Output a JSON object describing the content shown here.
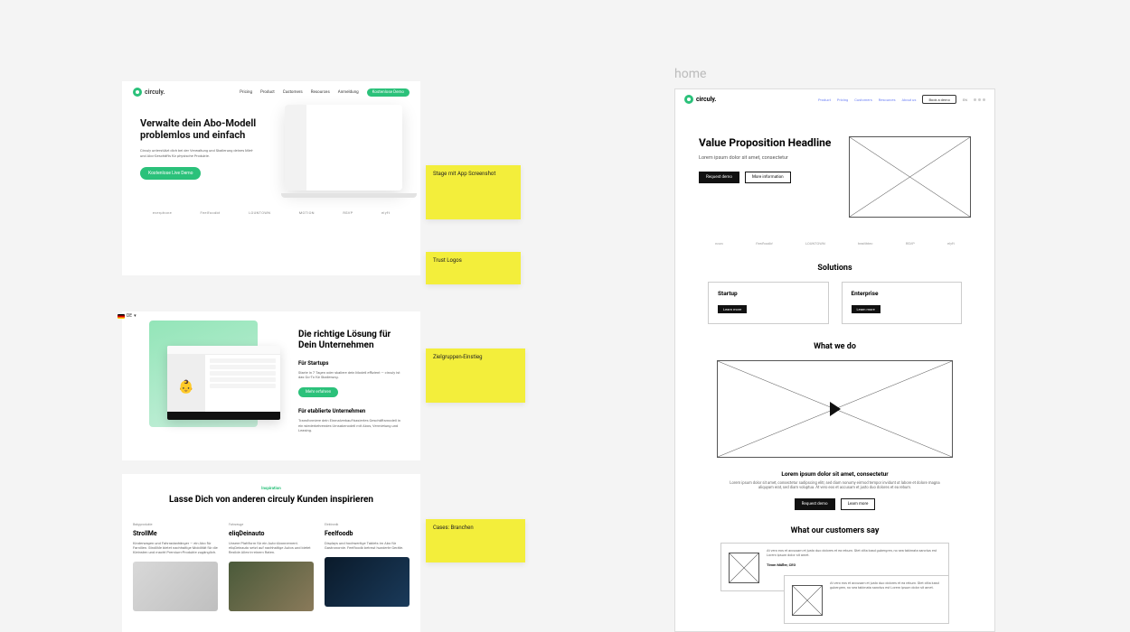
{
  "brand": "circuly.",
  "left": {
    "nav": {
      "items": [
        "Pricing",
        "Product",
        "Customers",
        "Resources"
      ],
      "login": "Anmeldung",
      "cta": "Kostenlose Demo"
    },
    "hero": {
      "headline": "Verwalte dein Abo-Modell problemlos und einfach",
      "sub": "Circuly unterstützt dich bei der Verwaltung und Skalierung deines Miet- und Abo-Geschäfts für physische Produkte.",
      "cta": "Kostenlose Live Demo",
      "trust": [
        "everphone",
        "Feelfoodbt",
        "LOUNTOWN",
        "MOTION",
        "RSVP",
        "elyft"
      ]
    },
    "solutions": {
      "lang": "DE",
      "title": "Die richtige Lösung für Dein Unternehmen",
      "startup_h": "Für Startups",
      "startup_p": "Starte in 7 Tagen oder skaliere dein Modell effizient — circuly ist das Go-To für Skalierung.",
      "startup_cta": "Mehr erfahren",
      "ent_h": "Für etablierte Unternehmen",
      "ent_p": "Transformiere dein Einmalverkauf-basiertes Geschäftsmodell in ein wiederkehrendes Umsatzmodell mit Abos, Vermietung und Leasing."
    },
    "cases": {
      "eyebrow": "Inspiration",
      "title": "Lasse Dich von anderen circuly Kunden inspirieren",
      "items": [
        {
          "cat": "Babyprodukte",
          "title": "StrollMe",
          "desc": "Kinderwagen und Fahrradanhänger — ein Abo für Familien. StrollMe bietet nachhaltige Mobilität für die Kleinsten und macht Premium-Produkte zugänglich."
        },
        {
          "cat": "Fahrzeuge",
          "title": "eliqDeinauto",
          "desc": "Unsere Plattform für ein Auto-Abonnement. eliqDeinauto setzt auf nachhaltige Autos und bietet flexible Alles-in-einem Raten."
        },
        {
          "cat": "Elektronik",
          "title": "Feelfoodb",
          "desc": "Displays und hochwertige Tablets im Abo für Gastronomie. Feelfoodb betreut hunderte Geräte."
        }
      ]
    }
  },
  "notes": {
    "hero": "Stage mit App Screenshot",
    "trust": "Trust Logos",
    "solutions": "Zielgruppen-Einstieg",
    "cases": "Cases: Branchen"
  },
  "wf_label": "home",
  "wf": {
    "nav": {
      "items": [
        "Product",
        "Pricing",
        "Customers",
        "Resources",
        "About us"
      ],
      "cta": "Book a demo",
      "lang": "EN"
    },
    "hero": {
      "h1": "Value Proposition Headline",
      "p": "Lorem ipsum dolor sit amet, consectetur",
      "btn1": "Request demo",
      "btn2": "More information"
    },
    "trust": [
      "novo",
      "Feelfoodbt",
      "LOUNTOWN",
      "healthtec",
      "RSVP",
      "elyft"
    ],
    "solutions": {
      "title": "Solutions",
      "cards": [
        {
          "t": "Startup",
          "b": "Learn more"
        },
        {
          "t": "Enterprise",
          "b": "Learn more"
        }
      ]
    },
    "whatwedo": "What we do",
    "body": {
      "h": "Lorem ipsum dolor sit amet, consectetur",
      "p": "Lorem ipsum dolor sit amet, consectetur sadipscing elitr, sed diam nonumy eirmod tempor invidunt ut labore et dolore magna aliquyam erat, sed diam voluptua. At vero eos et accusam et justo duo dolores et ea rebum.",
      "btn1": "Request demo",
      "btn2": "Learn more"
    },
    "customers": {
      "title": "What our customers say",
      "quote": "At vero eos et accusam et justo duo dolores et ea rebum. Stet clita kasd gubergren, no sea takimata sanctus est Lorem ipsum dolor sit amet.",
      "name": "Timm Müller, CEO"
    }
  }
}
